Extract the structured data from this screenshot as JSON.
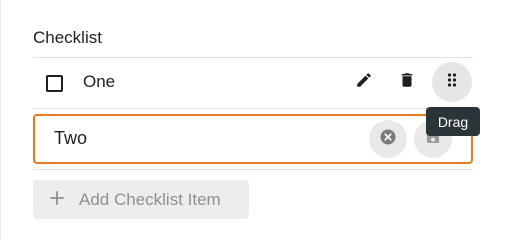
{
  "checklist": {
    "title": "Checklist",
    "items": [
      {
        "label": "One",
        "checked": false
      }
    ],
    "editing_item": {
      "value": "Two"
    },
    "tooltip": "Drag",
    "add_button_label": "Add Checklist Item",
    "add_button_icon": "plus-icon"
  },
  "colors": {
    "accent_border": "#e67a1e",
    "tooltip_bg": "#2b3438",
    "icon_dark": "#1f1f1f",
    "muted_text": "#8f8f8f"
  }
}
